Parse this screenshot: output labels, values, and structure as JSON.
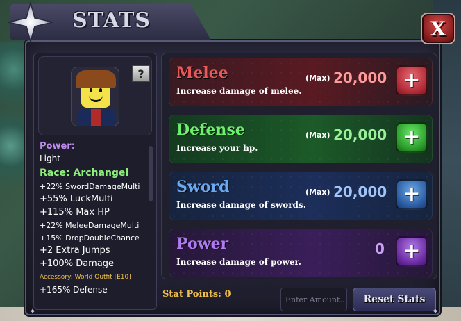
{
  "window": {
    "title": "STATS",
    "close_label": "X"
  },
  "profile": {
    "help_label": "?",
    "power_label": "Power:",
    "power_value": "Light",
    "race": "Race: Archangel",
    "buffs": [
      "+22% SwordDamageMulti",
      "+55% LuckMulti",
      "+115% Max HP",
      "+22% MeleeDamageMulti",
      "+15% DropDoubleChance",
      "+2 Extra Jumps",
      "+100% Damage"
    ],
    "accessory": "Accessory: World Outfit [E10]",
    "last_line": "+165% Defense"
  },
  "stats": [
    {
      "name": "Melee",
      "description": "Increase damage of melee.",
      "max_label": "(Max)",
      "value": "20,000",
      "color": "#e85a5a",
      "value_color": "#ff8080"
    },
    {
      "name": "Defense",
      "description": "Increase your hp.",
      "max_label": "(Max)",
      "value": "20,000",
      "color": "#6ef06e",
      "value_color": "#8af08a"
    },
    {
      "name": "Sword",
      "description": "Increase damage of swords.",
      "max_label": "(Max)",
      "value": "20,000",
      "color": "#6aa8f0",
      "value_color": "#9ac0f8"
    },
    {
      "name": "Power",
      "description": "Increase damage of power.",
      "max_label": "",
      "value": "0",
      "color": "#b07af0",
      "value_color": "#c8a0f8"
    }
  ],
  "footer": {
    "stat_points": "Stat Points: 0",
    "amount_placeholder": "Enter Amount..",
    "reset_label": "Reset Stats"
  },
  "icons": {
    "plus": "+",
    "star": "four-point-star-icon"
  }
}
